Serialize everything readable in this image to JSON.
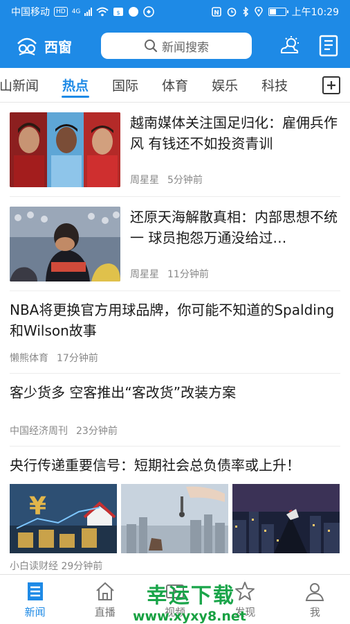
{
  "status_bar": {
    "carrier": "中国移动",
    "hd": "HD",
    "network": "4G",
    "time": "上午10:29",
    "battery_level": 0.45
  },
  "header": {
    "app_name": "西窗",
    "search_placeholder": "新闻搜索",
    "accent_color": "#1e8ae6"
  },
  "tabs": {
    "items": [
      "山新闻",
      "热点",
      "国际",
      "体育",
      "娱乐",
      "科技"
    ],
    "active_index": 1
  },
  "feed": [
    {
      "title": "越南媒体关注国足归化：雇佣兵作风 有钱还不如投资青训",
      "source": "周星星",
      "time": "5分钟前",
      "layout": "thumb"
    },
    {
      "title": "还原天海解散真相：内部思想不统一 球员抱怨万通没给过…",
      "source": "周星星",
      "time": "11分钟前",
      "layout": "thumb"
    },
    {
      "title": "NBA将更换官方用球品牌，你可能不知道的Spalding和Wilson故事",
      "source": "懒熊体育",
      "time": "17分钟前",
      "layout": "text"
    },
    {
      "title": "客少货多 空客推出“客改货”改装方案",
      "source": "中国经济周刊",
      "time": "23分钟前",
      "layout": "text"
    },
    {
      "title": "央行传递重要信号：短期社会总负债率或上升！",
      "source": "小白读财经",
      "time": "29分钟前",
      "layout": "three-image"
    }
  ],
  "bottom_nav": {
    "items": [
      "新闻",
      "直播",
      "视频",
      "发现",
      "我"
    ],
    "active_index": 0
  },
  "watermark": {
    "line1": "幸运下载",
    "line2": "www.xyxy8.net"
  }
}
